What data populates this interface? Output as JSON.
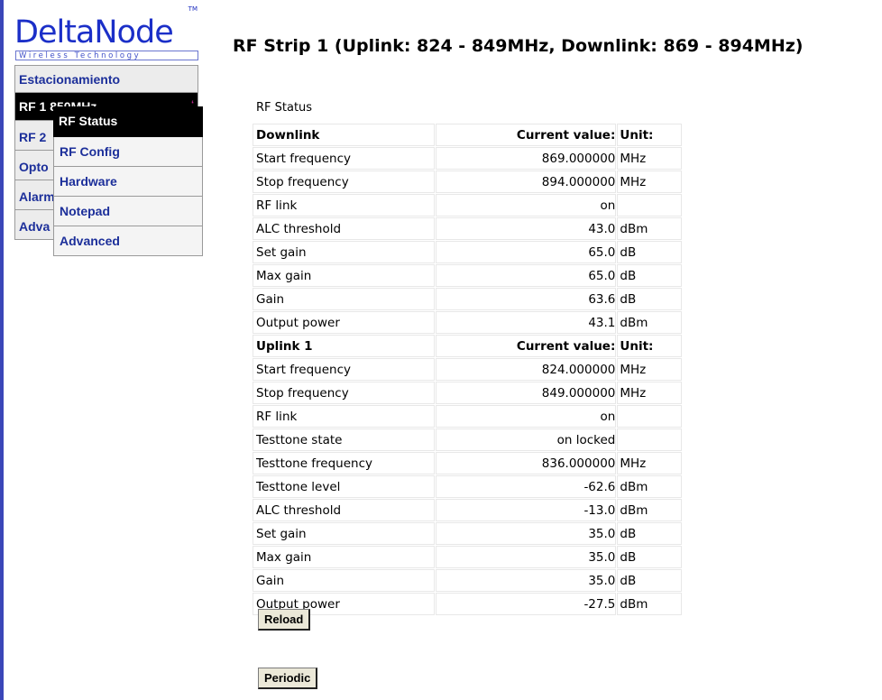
{
  "logo": {
    "brand": "DeltaNode",
    "tagline": "Wireless Technology",
    "tm": "TM"
  },
  "menu": [
    {
      "label": "Estacionamiento"
    },
    {
      "label": "RF 1 850MHz"
    },
    {
      "label": "RF 2"
    },
    {
      "label": "Opto"
    },
    {
      "label": "Alarm"
    },
    {
      "label": "Adva"
    }
  ],
  "submenu": [
    {
      "label": "RF Status"
    },
    {
      "label": "RF Config"
    },
    {
      "label": "Hardware"
    },
    {
      "label": "Notepad"
    },
    {
      "label": "Advanced"
    }
  ],
  "heading": "RF Strip  1 (Uplink:  824 - 849MHz, Downlink:  869 - 894MHz)",
  "table_caption": "RF Status",
  "rows": [
    {
      "hdr": true,
      "name": "Downlink",
      "value": "Current value:",
      "unit": "Unit:"
    },
    {
      "name": "Start frequency",
      "value": "869.000000",
      "unit": "MHz"
    },
    {
      "name": "Stop frequency",
      "value": "894.000000",
      "unit": "MHz"
    },
    {
      "name": "RF link",
      "value": "on",
      "unit": ""
    },
    {
      "name": "ALC threshold",
      "value": "43.0",
      "unit": "dBm"
    },
    {
      "name": "Set gain",
      "value": "65.0",
      "unit": "dB"
    },
    {
      "name": "Max gain",
      "value": "65.0",
      "unit": "dB"
    },
    {
      "name": "Gain",
      "value": "63.6",
      "unit": "dB"
    },
    {
      "name": "Output power",
      "value": "43.1",
      "unit": "dBm"
    },
    {
      "hdr": true,
      "name": "Uplink 1",
      "value": "Current value:",
      "unit": "Unit:"
    },
    {
      "name": "Start frequency",
      "value": "824.000000",
      "unit": "MHz"
    },
    {
      "name": "Stop frequency",
      "value": "849.000000",
      "unit": "MHz"
    },
    {
      "name": "RF link",
      "value": "on",
      "unit": ""
    },
    {
      "name": "Testtone state",
      "value": "on locked",
      "unit": ""
    },
    {
      "name": "Testtone frequency",
      "value": "836.000000",
      "unit": "MHz"
    },
    {
      "name": "Testtone level",
      "value": "-62.6",
      "unit": "dBm"
    },
    {
      "name": "ALC threshold",
      "value": "-13.0",
      "unit": "dBm"
    },
    {
      "name": "Set gain",
      "value": "35.0",
      "unit": "dB"
    },
    {
      "name": "Max gain",
      "value": "35.0",
      "unit": "dB"
    },
    {
      "name": "Gain",
      "value": "35.0",
      "unit": "dB"
    },
    {
      "name": "Output power",
      "value": "-27.5",
      "unit": "dBm"
    }
  ],
  "buttons": {
    "reload": "Reload",
    "periodic": "Periodic"
  },
  "colors": {
    "menu_text": "#1c2f9a",
    "logo_blue": "#1b2fc8",
    "left_bar": "#3a46b8"
  }
}
